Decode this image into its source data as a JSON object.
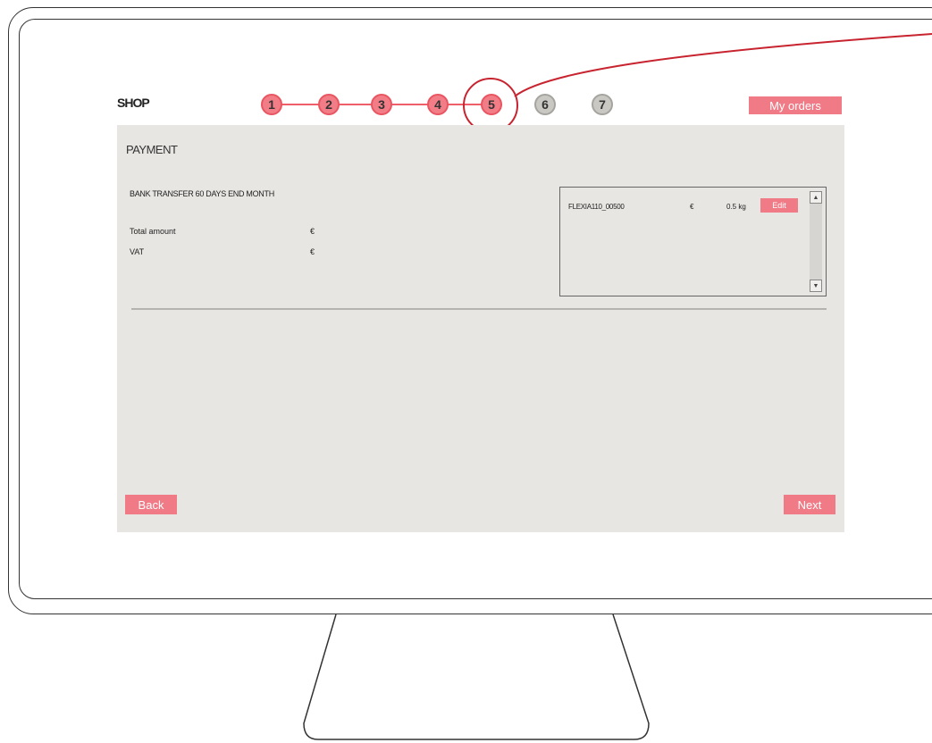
{
  "header": {
    "shop_label": "SHOP",
    "my_orders_label": "My orders"
  },
  "steps": [
    {
      "label": "1",
      "state": "done"
    },
    {
      "label": "2",
      "state": "done"
    },
    {
      "label": "3",
      "state": "done"
    },
    {
      "label": "4",
      "state": "done"
    },
    {
      "label": "5",
      "state": "current"
    },
    {
      "label": "6",
      "state": "todo"
    },
    {
      "label": "7",
      "state": "todo"
    }
  ],
  "payment": {
    "title": "PAYMENT",
    "method": "BANK TRANSFER 60 DAYS END MONTH",
    "total_label": "Total amount",
    "total_currency": "€",
    "vat_label": "VAT",
    "vat_currency": "€"
  },
  "cart": {
    "items": [
      {
        "code": "FLEXIA110_00500",
        "currency": "€",
        "weight": "0.5 kg",
        "edit_label": "Edit"
      }
    ],
    "scroll_up": "▲",
    "scroll_down": "▼"
  },
  "footer": {
    "back_label": "Back",
    "next_label": "Next"
  },
  "colors": {
    "accent": "#f07b86",
    "step_done": "#f27d86",
    "step_todo": "#c9c8c3",
    "highlight": "#c8242f",
    "panel": "#e8e6e2"
  }
}
